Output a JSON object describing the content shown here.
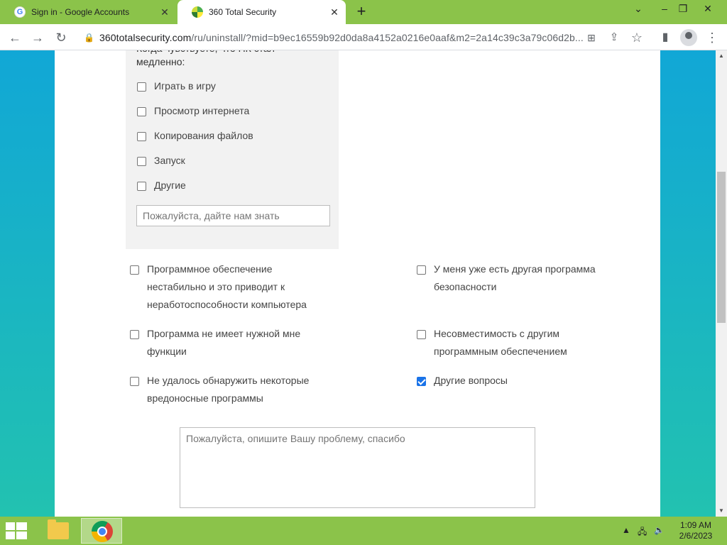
{
  "browser": {
    "tabs": [
      {
        "title": "Sign in - Google Accounts",
        "favicon": "google-icon",
        "active": false
      },
      {
        "title": "360 Total Security",
        "favicon": "360-security-icon",
        "active": true
      }
    ],
    "url_host": "360totalsecurity.com",
    "url_rest": "/ru/uninstall/?mid=b9ec16559b92d0da8a4152a0216e0aaf&m2=2a14c39c3a79c06d2b..."
  },
  "form": {
    "slow_question_line1": "Когда чувствуете, что ПК стал",
    "slow_question_line2": "медленно:",
    "slow_options": [
      {
        "label": "Играть в игру",
        "checked": false
      },
      {
        "label": "Просмотр интернета",
        "checked": false
      },
      {
        "label": "Копирования файлов",
        "checked": false
      },
      {
        "label": "Запуск",
        "checked": false
      },
      {
        "label": "Другие",
        "checked": false
      }
    ],
    "slow_input_placeholder": "Пожалуйста, дайте нам знать",
    "reasons": [
      {
        "lines": [
          "Программное обеспечение",
          "нестабильно и это приводит к",
          "неработоспособности компьютера"
        ],
        "checked": false
      },
      {
        "lines": [
          "У меня уже есть другая программа",
          "безопасности"
        ],
        "checked": false
      },
      {
        "lines": [
          "Программа не имеет нужной мне",
          "функции"
        ],
        "checked": false
      },
      {
        "lines": [
          "Несовместимость с другим",
          "программным обеспечением"
        ],
        "checked": false
      },
      {
        "lines": [
          "Не удалось обнаружить некоторые",
          "вредоносные программы"
        ],
        "checked": false
      },
      {
        "lines": [
          "Другие вопросы"
        ],
        "checked": true
      }
    ],
    "problem_placeholder": "Пожалуйста, опишите Вашу проблему, спасибо"
  },
  "taskbar": {
    "time": "1:09 AM",
    "date": "2/6/2023"
  },
  "colors": {
    "tab_strip": "#8bc34a",
    "checkbox_checked": "#1a73e8",
    "page_gradient_top": "#11a7d6",
    "page_gradient_bottom": "#22c2b0"
  }
}
